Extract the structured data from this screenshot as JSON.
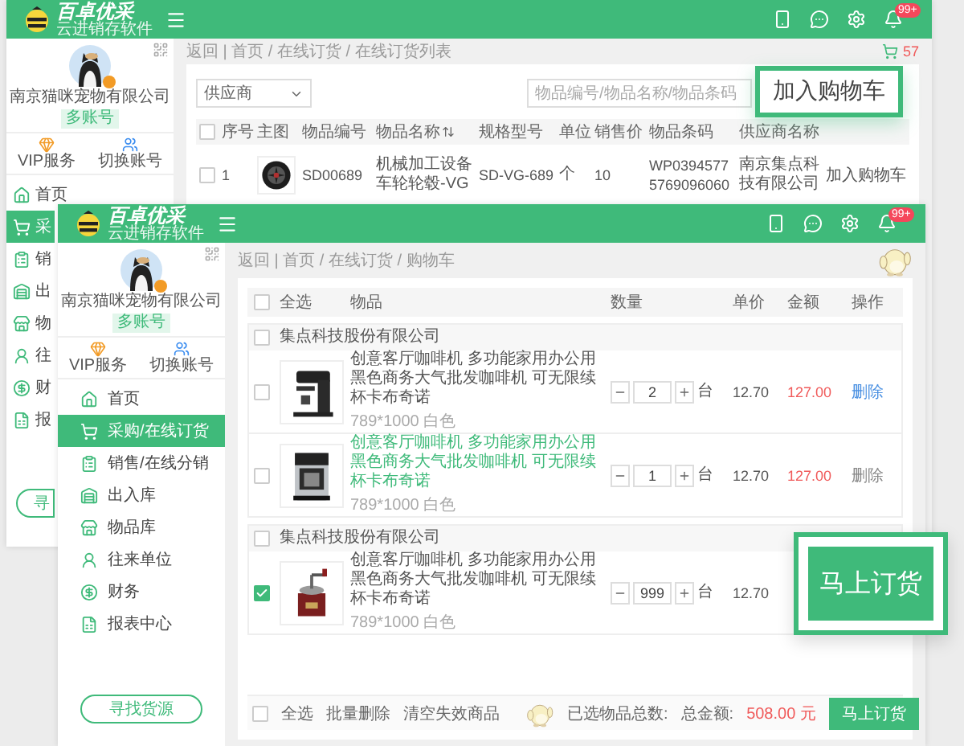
{
  "back_window": {
    "header": {
      "logo": "百卓优采",
      "slogan": "云进销存软件",
      "badge": "99+"
    },
    "sidebar": {
      "company": "南京猫咪宠物有限公司",
      "account_badge": "多账号",
      "shortcuts": [
        "VIP服务",
        "切换账号"
      ],
      "items": [
        {
          "label": "首页",
          "selected": false
        },
        {
          "label": "采",
          "selected": true
        },
        {
          "label": "销",
          "selected": false
        },
        {
          "label": "出",
          "selected": false
        },
        {
          "label": "物",
          "selected": false
        },
        {
          "label": "往",
          "selected": false
        },
        {
          "label": "财",
          "selected": false
        },
        {
          "label": "报",
          "selected": false
        }
      ],
      "button": "寻"
    },
    "breadcrumb": "返回 | 首页 / 在线订货 / 在线订货列表",
    "cart_count": "57",
    "supplier_select": {
      "placeholder": "供应商"
    },
    "search": {
      "placeholder": "物品编号/物品名称/物品条码"
    },
    "table": {
      "select_all_checked": false,
      "columns": [
        {
          "label": "序号",
          "sortable": false
        },
        {
          "label": "主图",
          "sortable": false
        },
        {
          "label": "物品编号",
          "sortable": false
        },
        {
          "label": "物品名称",
          "sortable": true
        },
        {
          "label": "规格型号",
          "sortable": false
        },
        {
          "label": "单位",
          "sortable": false
        },
        {
          "label": "销售价",
          "sortable": false
        },
        {
          "label": "物品条码",
          "sortable": false
        },
        {
          "label": "供应商名称",
          "sortable": false
        }
      ],
      "rows": [
        {
          "checked": false,
          "index": "1",
          "code": "SD00689",
          "name": "机械加工设备车轮轮毂-VG",
          "model": "SD-VG-689",
          "unit": "个",
          "price": "10",
          "barcode": "WP03945775769096060",
          "supplier": "南京集点科技有限公司",
          "action": "加入购物车"
        }
      ]
    }
  },
  "front_window": {
    "header": {
      "logo": "百卓优采",
      "slogan": "云进销存软件",
      "badge": "99+"
    },
    "sidebar": {
      "company": "南京猫咪宠物有限公司",
      "account_badge": "多账号",
      "shortcuts": [
        "VIP服务",
        "切换账号"
      ],
      "items": [
        {
          "label": "首页",
          "selected": false
        },
        {
          "label": "采购/在线订货",
          "selected": true
        },
        {
          "label": "销售/在线分销",
          "selected": false
        },
        {
          "label": "出入库",
          "selected": false
        },
        {
          "label": "物品库",
          "selected": false
        },
        {
          "label": "往来单位",
          "selected": false
        },
        {
          "label": "财务",
          "selected": false
        },
        {
          "label": "报表中心",
          "selected": false
        }
      ],
      "button": "寻找货源"
    },
    "breadcrumb": "返回 | 首页 / 在线订货 / 购物车",
    "cart": {
      "columns": [
        "全选",
        "物品",
        "数量",
        "单价",
        "金额",
        "操作"
      ],
      "select_all_checked": false,
      "groups": [
        {
          "supplier": "集点科技股份有限公司",
          "checked": false,
          "items": [
            {
              "checked": false,
              "title": "创意客厅咖啡机 多功能家用办公用黑色商务大气批发咖啡机 可无限续杯卡布奇诺",
              "title_hovered": false,
              "spec": "789*1000 白色",
              "quantity": "2",
              "unit": "台",
              "price": "12.70",
              "amount": "127.00",
              "delete": "删除",
              "delete_hovered": true
            },
            {
              "checked": false,
              "title": "创意客厅咖啡机 多功能家用办公用黑色商务大气批发咖啡机 可无限续杯卡布奇诺",
              "title_hovered": true,
              "spec": "789*1000 白色",
              "quantity": "1",
              "unit": "台",
              "price": "12.70",
              "amount": "127.00",
              "delete": "删除",
              "delete_hovered": false
            }
          ]
        },
        {
          "supplier": "集点科技股份有限公司",
          "checked": false,
          "items": [
            {
              "checked": true,
              "title": "创意客厅咖啡机 多功能家用办公用黑色商务大气批发咖啡机 可无限续杯卡布奇诺",
              "title_hovered": false,
              "spec": "789*1000 白色",
              "quantity": "999",
              "unit": "台",
              "price": "12.70"
            }
          ]
        }
      ],
      "footer": {
        "checked": false,
        "select_all": "全选",
        "batch_delete": "批量删除",
        "clear_invalid": "清空失效商品",
        "selected_count_label": "已选物品总数:",
        "total_label": "总金额:",
        "total": "508.00 元",
        "order_button": "马上订货"
      }
    }
  },
  "callouts": {
    "add_to_cart": "加入购物车",
    "order": "马上订货"
  }
}
